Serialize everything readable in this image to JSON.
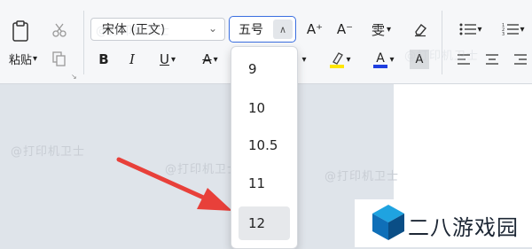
{
  "clipboard": {
    "paste_label": "粘贴",
    "paste_dropdown": "▾"
  },
  "font": {
    "name": "宋体 (正文)",
    "size": "五号",
    "name_chevron": "⌄",
    "size_up": "∧"
  },
  "toolbar": {
    "bold": "B",
    "italic": "I",
    "underline": "U",
    "strike": "A",
    "grow": "A⁺",
    "shrink": "A⁻",
    "phonetic": "雯",
    "highlight_color": "#ffe600",
    "font_color": "#1f3fe0"
  },
  "size_options": [
    "9",
    "10",
    "10.5",
    "11",
    "12"
  ],
  "selected_option": "12",
  "watermark": "@打印机卫士",
  "logo": {
    "text": "二八游戏园",
    "colors": [
      "#1fa3e0",
      "#0f6fb8",
      "#0a4e86"
    ]
  },
  "arrow_color": "#e8403a"
}
